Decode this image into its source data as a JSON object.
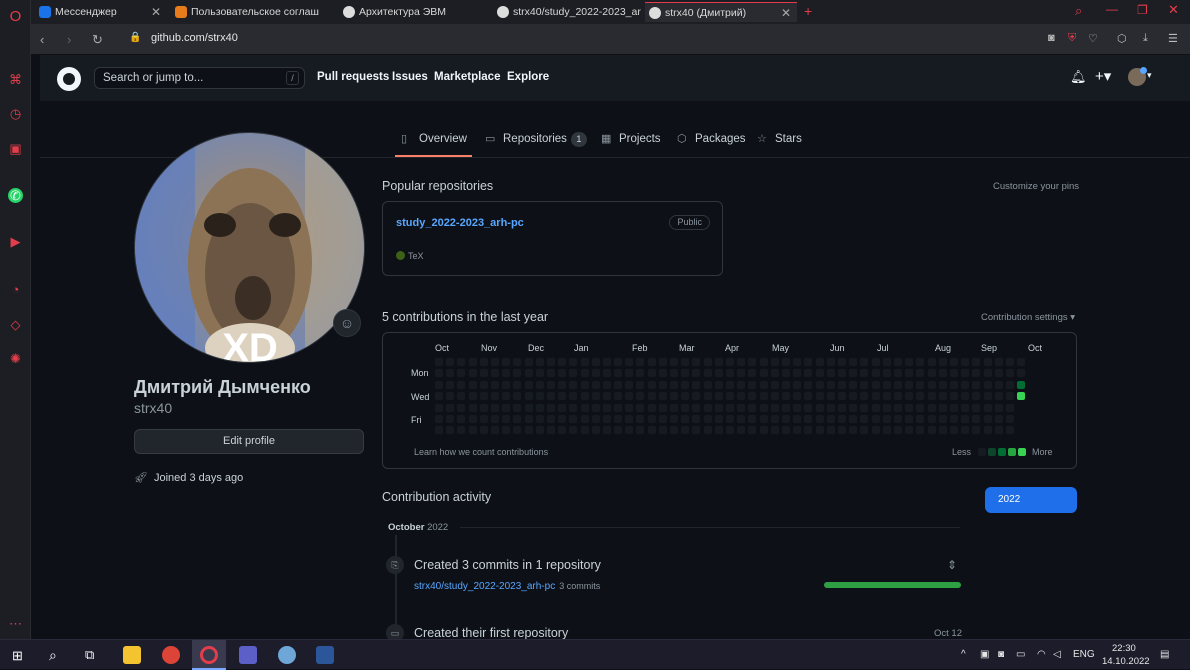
{
  "browser": {
    "tabs": [
      {
        "label": "Мессенджер",
        "color": "#1a73e8"
      },
      {
        "label": "Пользовательское соглаш",
        "color": "#e87b1a"
      },
      {
        "label": "Архитектура ЭВМ",
        "color": "#dddddd"
      },
      {
        "label": "strx40/study_2022-2023_ar",
        "color": "#dddddd"
      },
      {
        "label": "strx40 (Дмитрий)",
        "color": "#dddddd"
      }
    ],
    "url": "github.com/strx40"
  },
  "header": {
    "search_placeholder": "Search or jump to...",
    "search_key": "/",
    "nav": [
      "Pull requests",
      "Issues",
      "Marketplace",
      "Explore"
    ]
  },
  "profile_nav": {
    "overview": "Overview",
    "repositories": "Repositories",
    "repo_count": "1",
    "projects": "Projects",
    "packages": "Packages",
    "stars": "Stars"
  },
  "profile": {
    "avatar_text": "XD",
    "full_name": "Дмитрий Дымченко",
    "login": "strx40",
    "edit_label": "Edit profile",
    "joined": "Joined 3 days ago"
  },
  "popular": {
    "title": "Popular repositories",
    "customize": "Customize your pins",
    "repo_name": "study_2022-2023_arh-pc",
    "visibility": "Public",
    "language": "TeX",
    "language_color": "#3d6117"
  },
  "contributions": {
    "title": "5 contributions in the last year",
    "settings": "Contribution settings ▾",
    "months": [
      "Oct",
      "Nov",
      "Dec",
      "Jan",
      "Feb",
      "Mar",
      "Apr",
      "May",
      "Jun",
      "Jul",
      "Aug",
      "Sep",
      "Oct"
    ],
    "days": [
      "Mon",
      "Wed",
      "Fri"
    ],
    "learn": "Learn how we count contributions",
    "less": "Less",
    "more": "More",
    "colors": [
      "#161b22",
      "#0e4429",
      "#006d32",
      "#26a641",
      "#39d353"
    ]
  },
  "activity": {
    "title": "Contribution activity",
    "year": "2022",
    "month": "October",
    "month_year": "2022",
    "event1_title": "Created 3 commits in 1 repository",
    "event1_repo": "strx40/study_2022-2023_arh-pc",
    "event1_count": "3 commits",
    "event2_title": "Created their first repository",
    "event2_date": "Oct 12"
  },
  "taskbar": {
    "lang": "ENG",
    "time": "22:30",
    "date": "14.10.2022"
  }
}
